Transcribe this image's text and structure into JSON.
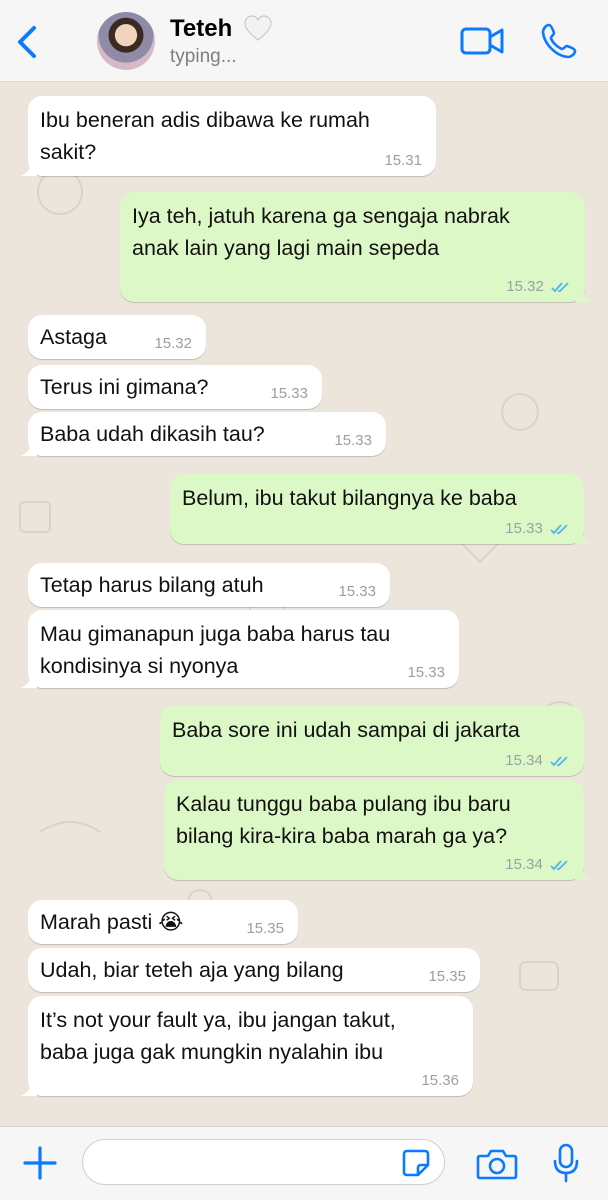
{
  "header": {
    "contact_name": "Teteh",
    "status": "typing...",
    "icons": {
      "back": "chevron-left-icon",
      "heart": "white-heart-icon",
      "video": "video-call-icon",
      "call": "phone-call-icon"
    },
    "accent_color": "#0a7aff"
  },
  "messages": [
    {
      "direction": "in",
      "text": "Ibu beneran adis dibawa ke rumah\nsakit?",
      "time": "15.31"
    },
    {
      "direction": "out",
      "text": "Iya teh, jatuh karena ga sengaja nabrak\nanak lain yang lagi main sepeda",
      "time": "15.32"
    },
    {
      "direction": "in",
      "text": "Astaga",
      "time": "15.32"
    },
    {
      "direction": "in",
      "text": "Terus ini gimana?",
      "time": "15.33"
    },
    {
      "direction": "in",
      "text": "Baba udah dikasih tau?",
      "time": "15.33"
    },
    {
      "direction": "out",
      "text": "Belum, ibu takut bilangnya ke baba",
      "time": "15.33"
    },
    {
      "direction": "in",
      "text": "Tetap harus bilang atuh",
      "time": "15.33"
    },
    {
      "direction": "in",
      "text": "Mau gimanapun juga baba harus tau\nkondisinya si nyonya",
      "time": "15.33"
    },
    {
      "direction": "out",
      "text": "Baba sore ini udah sampai di jakarta",
      "time": "15.34"
    },
    {
      "direction": "out",
      "text": "Kalau tunggu baba pulang ibu baru\nbilang kira-kira baba marah ga ya?",
      "time": "15.34"
    },
    {
      "direction": "in",
      "text": "Marah pasti 😭",
      "time": "15.35"
    },
    {
      "direction": "in",
      "text": "Udah, biar teteh aja yang bilang",
      "time": "15.35"
    },
    {
      "direction": "in",
      "text": "It’s not your fault ya, ibu jangan takut,\nbaba juga gak mungkin nyalahin ibu",
      "time": "15.36"
    }
  ],
  "composer": {
    "placeholder": "",
    "icons": {
      "attach": "plus-icon",
      "sticker": "sticker-icon",
      "camera": "camera-icon",
      "mic": "microphone-icon"
    }
  },
  "colors": {
    "incoming_bubble": "#ffffff",
    "outgoing_bubble": "#dcf8c6",
    "read_ticks": "#4fb6ec",
    "chat_background": "#ece5dc"
  }
}
